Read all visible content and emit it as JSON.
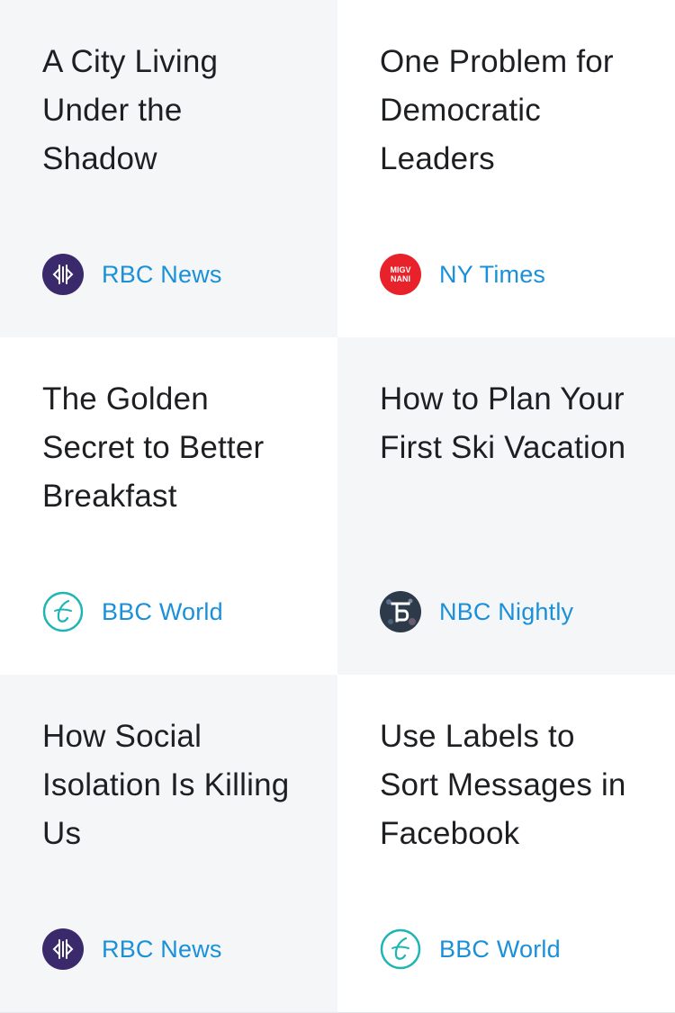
{
  "cards": [
    {
      "title": "A City Living Under the Shadow",
      "source": "RBC News",
      "logo_icon": "rbc-news-logo-icon",
      "logo_color": "#3b2a6b"
    },
    {
      "title": "One Problem for Democratic Leaders",
      "source": "NY Times",
      "logo_icon": "ny-times-logo-icon",
      "logo_color": "#e8222a",
      "logo_text": [
        "MIGV",
        "NANI"
      ]
    },
    {
      "title": "The Golden Secret to Better Breakfast",
      "source": "BBC World",
      "logo_icon": "bbc-world-logo-icon",
      "logo_color": "#1fb5b5"
    },
    {
      "title": "How to Plan Your First Ski Vacation",
      "source": "NBC Nightly",
      "logo_icon": "nbc-nightly-logo-icon",
      "logo_color": "#2c3a4a"
    },
    {
      "title": "How Social Isolation Is Killing Us",
      "source": "RBC News",
      "logo_icon": "rbc-news-logo-icon",
      "logo_color": "#3b2a6b"
    },
    {
      "title": "Use Labels to Sort Messages in Facebook",
      "source": "BBC World",
      "logo_icon": "bbc-world-logo-icon",
      "logo_color": "#1fb5b5"
    }
  ],
  "colors": {
    "shaded_bg": "#f5f6f8",
    "title_text": "#1d1f22",
    "source_link": "#1a90d9"
  }
}
